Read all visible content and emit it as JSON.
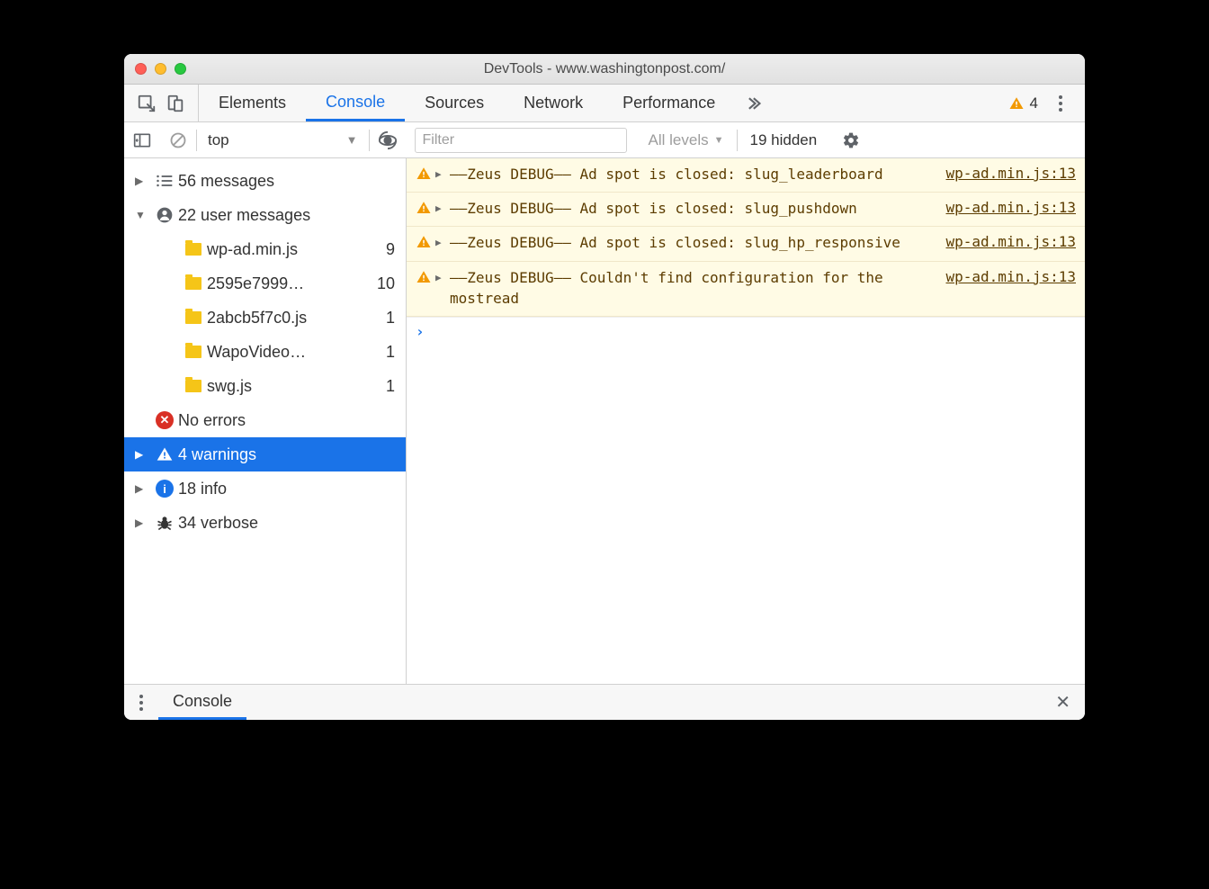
{
  "window": {
    "title": "DevTools - www.washingtonpost.com/"
  },
  "tabs": {
    "items": [
      "Elements",
      "Console",
      "Sources",
      "Network",
      "Performance"
    ],
    "active": 1,
    "warn_count": "4"
  },
  "subtoolbar": {
    "context": "top",
    "filter_placeholder": "Filter",
    "levels_label": "All levels",
    "hidden_label": "19 hidden"
  },
  "sidebar": {
    "messages": {
      "label": "56 messages"
    },
    "user": {
      "label": "22 user messages"
    },
    "files": [
      {
        "name": "wp-ad.min.js",
        "count": "9"
      },
      {
        "name": "2595e7999…",
        "count": "10"
      },
      {
        "name": "2abcb5f7c0.js",
        "count": "1"
      },
      {
        "name": "WapoVideo…",
        "count": "1"
      },
      {
        "name": "swg.js",
        "count": "1"
      }
    ],
    "errors": {
      "label": "No errors"
    },
    "warnings": {
      "label": "4 warnings"
    },
    "info": {
      "label": "18 info"
    },
    "verbose": {
      "label": "34 verbose"
    }
  },
  "messages": [
    {
      "text": "––Zeus DEBUG–– Ad spot is closed: slug_leaderboard",
      "src": "wp-ad.min.js:13"
    },
    {
      "text": "––Zeus DEBUG–– Ad spot is closed: slug_pushdown",
      "src": "wp-ad.min.js:13"
    },
    {
      "text": "––Zeus DEBUG–– Ad spot is closed: slug_hp_responsive",
      "src": "wp-ad.min.js:13"
    },
    {
      "text": "––Zeus DEBUG–– Couldn't find configuration for the mostread",
      "src": "wp-ad.min.js:13"
    }
  ],
  "drawer": {
    "tab": "Console"
  }
}
